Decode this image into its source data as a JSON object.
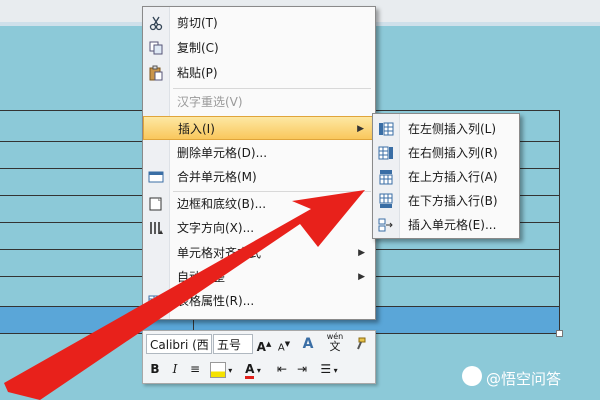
{
  "context_menu": {
    "items": [
      {
        "label": "剪切(T)",
        "icon": "scissors-icon",
        "enabled": true
      },
      {
        "label": "复制(C)",
        "icon": "copy-icon",
        "enabled": true
      },
      {
        "label": "粘贴(P)",
        "icon": "paste-icon",
        "enabled": true
      },
      {
        "label": "汉字重选(V)",
        "icon": "",
        "enabled": false
      },
      {
        "label": "插入(I)",
        "icon": "",
        "enabled": true,
        "submenu": true,
        "highlighted": true
      },
      {
        "label": "删除单元格(D)...",
        "icon": "",
        "enabled": true
      },
      {
        "label": "合并单元格(M)",
        "icon": "merge-cells-icon",
        "enabled": true
      },
      {
        "label": "边框和底纹(B)...",
        "icon": "borders-icon",
        "enabled": true
      },
      {
        "label": "文字方向(X)...",
        "icon": "text-direction-icon",
        "enabled": true
      },
      {
        "label": "单元格对齐方式",
        "icon": "",
        "enabled": true,
        "submenu": true
      },
      {
        "label": "自动调整",
        "icon": "",
        "enabled": true,
        "submenu": true
      },
      {
        "label": "表格属性(R)...",
        "icon": "table-properties-icon",
        "enabled": true
      }
    ]
  },
  "insert_submenu": {
    "items": [
      {
        "label": "在左侧插入列(L)",
        "icon": "insert-column-left-icon"
      },
      {
        "label": "在右侧插入列(R)",
        "icon": "insert-column-right-icon"
      },
      {
        "label": "在上方插入行(A)",
        "icon": "insert-row-above-icon"
      },
      {
        "label": "在下方插入行(B)",
        "icon": "insert-row-below-icon"
      },
      {
        "label": "插入单元格(E)...",
        "icon": "insert-cells-icon"
      }
    ]
  },
  "mini_toolbar": {
    "font_name": "Calibri (西",
    "font_size": "五号",
    "grow_font": "A",
    "shrink_font": "A",
    "styles": "A",
    "phonetic": "wén",
    "bold": "B",
    "italic": "I",
    "font_color": "A"
  },
  "watermark": {
    "text": "@悟空问答"
  },
  "colors": {
    "background": "#8cc9d8",
    "selected_row": "#5aa6d8",
    "highlight": "#f9c75c",
    "arrow": "#e8211b"
  }
}
